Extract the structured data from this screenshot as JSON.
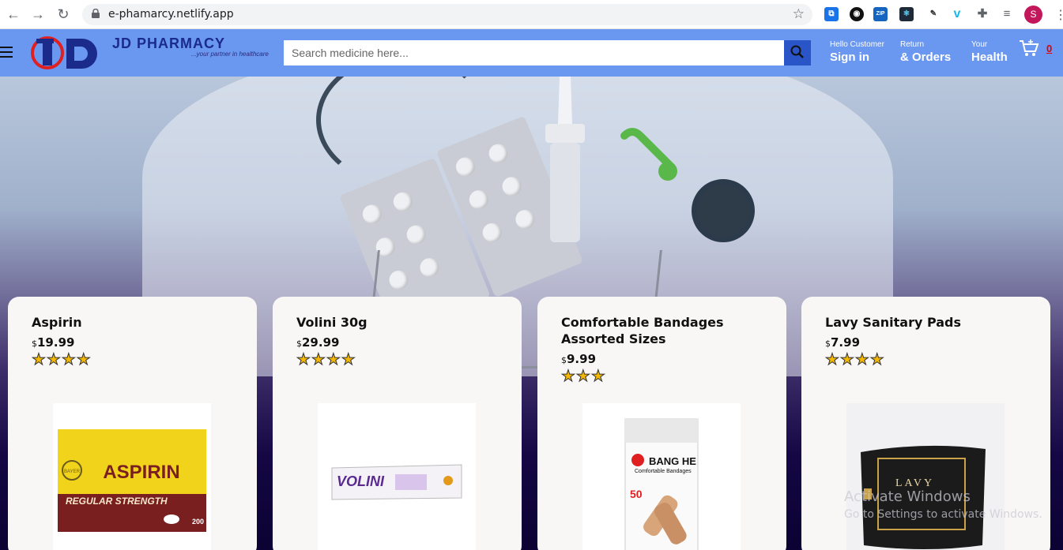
{
  "browser": {
    "url": "e-phamarcy.netlify.app",
    "profile_initial": "S",
    "ext_zip": "ZIP"
  },
  "header": {
    "brand_name": "JD PHARMACY",
    "tagline": "...your partner in healthcare",
    "search_placeholder": "Search medicine here...",
    "account": {
      "small": "Hello Customer",
      "big": "Sign in"
    },
    "orders": {
      "small": "Return",
      "big": "& Orders"
    },
    "health": {
      "small": "Your",
      "big": "Health"
    },
    "cart_count": "0"
  },
  "products": [
    {
      "name": "Aspirin",
      "currency": "$",
      "price": "19.99",
      "rating": 4,
      "stars": "★★★★"
    },
    {
      "name": "Volini 30g",
      "currency": "$",
      "price": "29.99",
      "rating": 4,
      "stars": "★★★★"
    },
    {
      "name": "Comfortable Bandages Assorted Sizes",
      "currency": "$",
      "price": "9.99",
      "rating": 3,
      "stars": "★★★"
    },
    {
      "name": "Lavy Sanitary Pads",
      "currency": "$",
      "price": "7.99",
      "rating": 4,
      "stars": "★★★★"
    }
  ],
  "product_images": {
    "aspirin": {
      "brand": "ASPIRIN",
      "strength": "REGULAR STRENGTH",
      "count": "200",
      "maker": "BAYER"
    },
    "volini": {
      "brand": "VOLINI"
    },
    "bandage": {
      "brand": "BANG HE",
      "sub": "Comfortable Bandages",
      "count": "50"
    },
    "lavy": {
      "brand": "LAVY"
    }
  },
  "watermark": {
    "line1": "Activate Windows",
    "line2": "Go to Settings to activate Windows."
  }
}
